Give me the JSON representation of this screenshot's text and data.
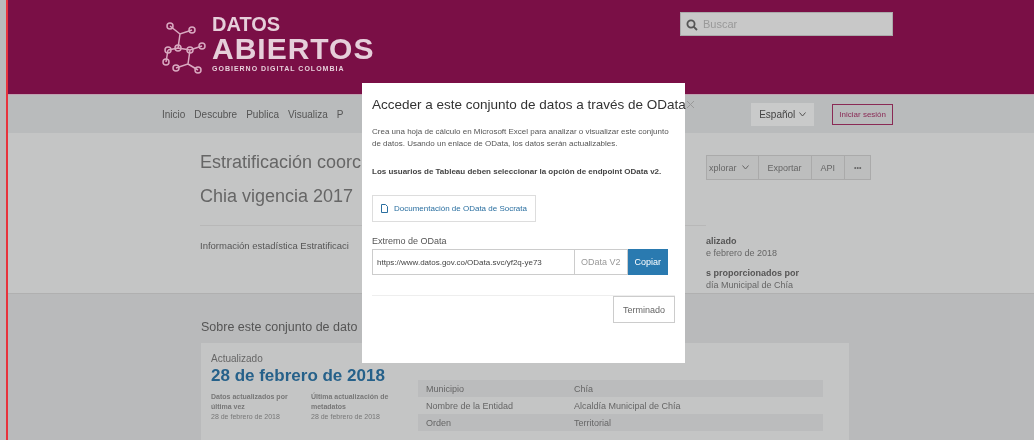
{
  "header": {
    "logo": {
      "line1": "DATOS",
      "line2": "ABIERTOS",
      "line3": "GOBIERNO DIGITAL COLOMBIA"
    },
    "search": {
      "placeholder": "Buscar"
    }
  },
  "nav": {
    "items": [
      {
        "label": "Inicio"
      },
      {
        "label": "Descubre"
      },
      {
        "label": "Publica"
      },
      {
        "label": "Visualiza"
      },
      {
        "label": "P"
      }
    ],
    "language": "Español",
    "signin": "Iniciar sesión"
  },
  "dataset": {
    "title_lines": [
      "Estratificación coorc",
      "Chia vigencia 2017"
    ],
    "actions": [
      {
        "label": "xplorar",
        "kind": "dropdown"
      },
      {
        "label": "Exportar",
        "kind": "plain"
      },
      {
        "label": "API",
        "kind": "plain"
      },
      {
        "label": "•••",
        "kind": "more"
      }
    ],
    "description": "Información estadística Estratificaci",
    "meta": [
      {
        "kind": "label",
        "text": "alizado"
      },
      {
        "kind": "value",
        "text": "e febrero de 2018"
      },
      {
        "kind": "label",
        "text": "s proporcionados por"
      },
      {
        "kind": "value",
        "text": "día Municipal de Chía"
      }
    ]
  },
  "about": {
    "heading": "Sobre este conjunto de dato",
    "updated_label": "Actualizado",
    "updated_date": "28 de febrero de 2018",
    "stats": [
      {
        "label": "Datos actualizados por última vez",
        "date": "28 de febrero de 2018"
      },
      {
        "label": "Última actualización de metadatos",
        "date": "28 de febrero de 2018"
      }
    ],
    "entity_rows": [
      {
        "field": "Municipio",
        "value": "Chía"
      },
      {
        "field": "Nombre de la Entidad",
        "value": "Alcaldía Municipal de Chía"
      },
      {
        "field": "Orden",
        "value": "Territorial"
      }
    ]
  },
  "modal": {
    "title": "Acceder a este conjunto de datos a través de OData",
    "intro": "Crea una hoja de cálculo en Microsoft Excel para analizar o visualizar este conjunto de datos. Usando un enlace de OData, los datos serán actualizables.",
    "tableau_note": "Los usuarios de Tableau deben seleccionar la opción de endpoint OData v2.",
    "doc_link": "Documentación de OData de Socrata",
    "endpoint_label": "Extremo de OData",
    "endpoint_value": "https://www.datos.gov.co/OData.svc/yf2q-ye73",
    "version_label": "OData V2",
    "copy_button": "Copiar",
    "done_button": "Terminado"
  }
}
